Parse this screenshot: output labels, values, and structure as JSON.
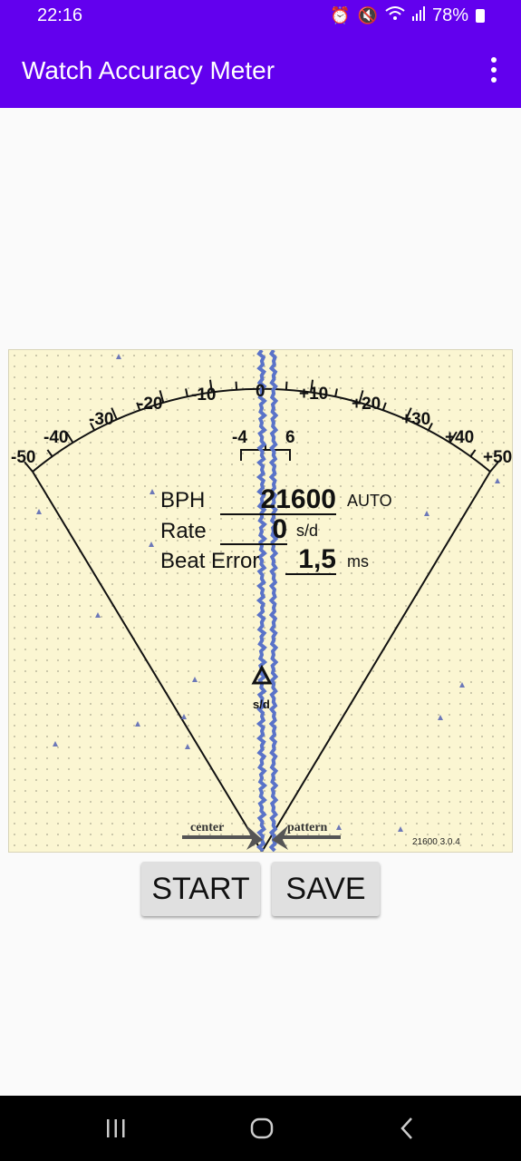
{
  "status_bar": {
    "time": "22:16",
    "battery": "78%"
  },
  "app_bar": {
    "title": "Watch Accuracy Meter"
  },
  "meter": {
    "scale_labels": [
      "-50",
      "-40",
      "-30",
      "-20",
      "-10",
      "0",
      "+10",
      "+20",
      "+30",
      "+40",
      "+50"
    ],
    "inner_labels": [
      "-4",
      "6"
    ],
    "bph_label": "BPH",
    "bph_value": "21600",
    "bph_mode": "AUTO",
    "rate_label": "Rate",
    "rate_value": "0",
    "rate_unit": "s/d",
    "beat_error_label": "Beat Error",
    "beat_error_value": "1,5",
    "beat_error_unit": "ms",
    "pointer_unit": "s/d",
    "center_label": "center",
    "pattern_label": "pattern",
    "version": "21600 3.0.4"
  },
  "buttons": {
    "start": "START",
    "save": "SAVE"
  },
  "colors": {
    "primary": "#6200ee",
    "paper": "#fbf6d2",
    "trace": "#5a73c8"
  }
}
